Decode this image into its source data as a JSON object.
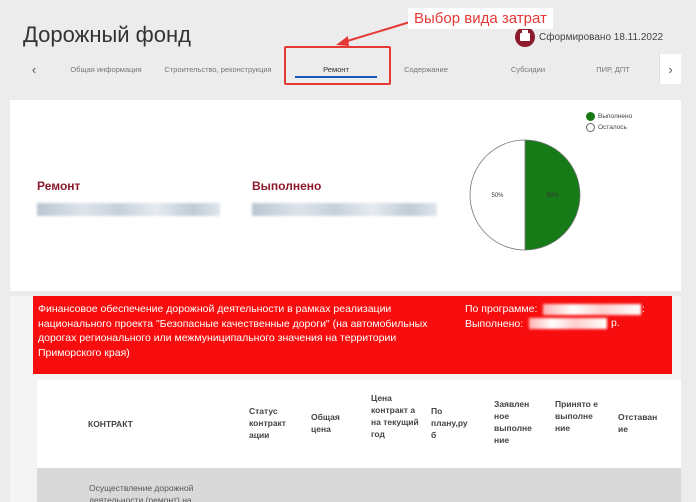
{
  "header": {
    "title": "Дорожный фонд",
    "generated_label": "Сформировано 18.11.2022",
    "print_icon": "printer-icon"
  },
  "annotation": {
    "text": "Выбор вида затрат",
    "color": "#e53935"
  },
  "tabs": {
    "prev_icon": "chevron-left-icon",
    "next_icon": "chevron-right-icon",
    "prev_glyph": "‹",
    "next_glyph": "›",
    "items": [
      {
        "label": "Общая информация"
      },
      {
        "label": "Строительство, реконструкция"
      },
      {
        "label": "Ремонт",
        "active": true
      },
      {
        "label": "Содержание"
      },
      {
        "label": "Субсидии"
      },
      {
        "label": "ПИР, ДПТ"
      }
    ]
  },
  "summary": {
    "repair_label": "Ремонт",
    "done_label": "Выполнено"
  },
  "chart_data": {
    "type": "pie",
    "slices": [
      {
        "name": "Выполнено",
        "value": 50,
        "label": "50%",
        "color": "#167a17"
      },
      {
        "name": "Осталось",
        "value": 50,
        "label": "50%",
        "color": "#ffffff"
      }
    ],
    "legend_position": "top-right"
  },
  "banner": {
    "description": "Финансовое обеспечение дорожной деятельности в рамках реализации национального проекта \"Безопасные качественные дороги\" (на автомобильных дорогах регионального или межмуниципального значения на территории Приморского края)",
    "program_label": "По программе:",
    "program_suffix": ":",
    "done_label": "Выполнено:",
    "done_suffix": "р.",
    "color": "#f70d0d"
  },
  "table": {
    "columns": [
      "КОНТРАКТ",
      "Статус контракт ации",
      "Общая цена",
      "Цена контракт а на текущий год",
      "По плану,ру б",
      "Заявлен ное выполне ние",
      "Принято е выполне ние",
      "Отставан ие"
    ],
    "rows": [
      {
        "contract": "Осуществление дорожной деятельности (ремонт) на"
      }
    ]
  }
}
